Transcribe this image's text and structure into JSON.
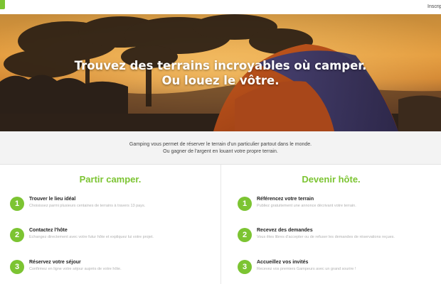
{
  "header": {
    "nav_signup": "Inscript",
    "colors": {
      "brand_green": "#7cc432"
    }
  },
  "hero": {
    "title_line1": "Trouvez des terrains incroyables où camper.",
    "title_line2": "Ou louez le vôtre."
  },
  "intro": {
    "line1": "Gamping vous permet de réserver le terrain d'un particulier partout dans le monde.",
    "line2": "Ou gagner de l'argent en louant votre propre terrain."
  },
  "camper": {
    "title": "Partir camper.",
    "steps": [
      {
        "num": "1",
        "title": "Trouver le lieu idéal",
        "desc": "Choisissez parmi plusieurs centaines de terrains à travers 13 pays."
      },
      {
        "num": "2",
        "title": "Contactez l'hôte",
        "desc": "Echangez directement avec votre futur hôte et expliquez lui votre projet."
      },
      {
        "num": "3",
        "title": "Réservez votre séjour",
        "desc": "Confirmez en ligne votre séjour auprès de votre hôte."
      }
    ]
  },
  "host": {
    "title": "Devenir hôte.",
    "steps": [
      {
        "num": "1",
        "title": "Référencez votre terrain",
        "desc": "Publiez gratuitement une annonce décrivant votre terrain."
      },
      {
        "num": "2",
        "title": "Recevez des demandes",
        "desc": "Vous êtes libres d'accepter ou de refuser les demandes de réservations reçues."
      },
      {
        "num": "3",
        "title": "Accueillez vos invités",
        "desc": "Recevez vos premiers Gampeurs avec un grand sourire !"
      }
    ]
  }
}
